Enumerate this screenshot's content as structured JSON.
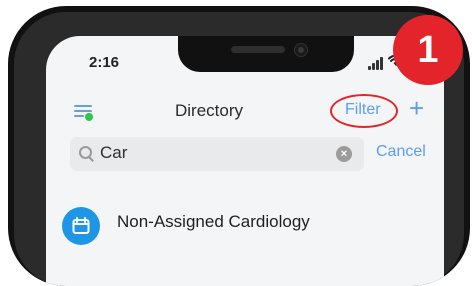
{
  "status_bar": {
    "time": "2:16",
    "icons": [
      "signal-icon",
      "wifi-icon"
    ]
  },
  "header": {
    "title": "Directory",
    "filter_label": "Filter",
    "add_label": "+"
  },
  "search": {
    "value": "Car",
    "cancel_label": "Cancel"
  },
  "results": [
    {
      "label": "Non-Assigned Cardiology",
      "icon": "calendar-icon"
    }
  ],
  "annotation": {
    "badge_number": "1",
    "highlight_color": "#e22529"
  },
  "colors": {
    "accent": "#5b9ef2",
    "badge": "#e3242b",
    "calendar_circle": "#1f95e6",
    "status_dot": "#2dc84d"
  }
}
